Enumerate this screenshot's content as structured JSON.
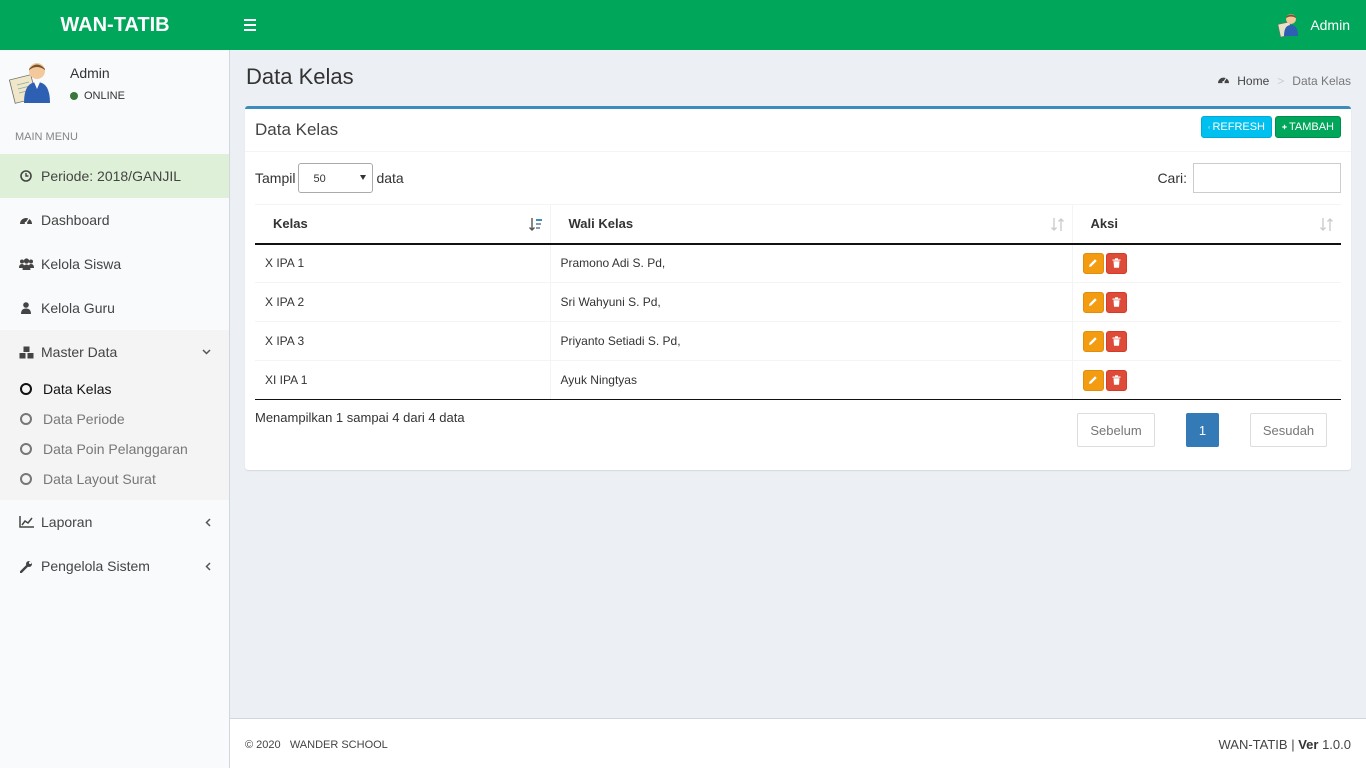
{
  "app": {
    "title": "WAN-TATIB"
  },
  "topbar": {
    "user": "Admin",
    "menu_icon": "bars-icon"
  },
  "sidebar": {
    "user": {
      "name": "Admin",
      "status": "ONLINE"
    },
    "menu_header": "MAIN MENU",
    "periode": "Periode: 2018/GANJIL",
    "items": [
      {
        "label": "Dashboard",
        "icon": "dashboard-icon"
      },
      {
        "label": "Kelola Siswa",
        "icon": "users-icon"
      },
      {
        "label": "Kelola Guru",
        "icon": "user-icon"
      },
      {
        "label": "Master Data",
        "icon": "cubes-icon"
      }
    ],
    "submenu": [
      {
        "label": "Data Kelas",
        "active": true
      },
      {
        "label": "Data Periode"
      },
      {
        "label": "Data Poin Pelanggaran"
      },
      {
        "label": "Data Layout Surat"
      }
    ],
    "after_items": [
      {
        "label": "Laporan",
        "icon": "line-chart-icon"
      },
      {
        "label": "Pengelola Sistem",
        "icon": "wrench-icon"
      }
    ]
  },
  "page": {
    "title": "Data Kelas",
    "breadcrumb": {
      "home": "Home",
      "current": "Data Kelas"
    }
  },
  "box": {
    "title": "Data Kelas",
    "refresh_label": "REFRESH",
    "tambah_label": "TAMBAH",
    "length": {
      "prefix": "Tampil",
      "value": "50",
      "suffix": "data"
    },
    "search": {
      "label": "Cari:",
      "value": ""
    },
    "columns": [
      "Kelas",
      "Wali Kelas",
      "Aksi"
    ],
    "rows": [
      {
        "kelas": "X IPA 1",
        "wali": "Pramono Adi S. Pd,"
      },
      {
        "kelas": "X IPA 2",
        "wali": "Sri Wahyuni S. Pd,"
      },
      {
        "kelas": "X IPA 3",
        "wali": "Priyanto Setiadi S. Pd,"
      },
      {
        "kelas": "XI IPA 1",
        "wali": "Ayuk Ningtyas"
      }
    ],
    "info": "Menampilkan 1 sampai 4 dari 4 data",
    "pager": {
      "prev": "Sebelum",
      "page": "1",
      "next": "Sesudah"
    }
  },
  "footer": {
    "copyright": "© 2020",
    "school": "WANDER SCHOOL",
    "app": "WAN-TATIB |",
    "ver_label": "Ver",
    "ver": "1.0.0"
  },
  "colors": {
    "header": "#00a65a",
    "box_border": "#3c8dbc",
    "refresh": "#00c0ef",
    "tambah": "#00a65a",
    "edit": "#f39c12",
    "delete": "#dd4b39",
    "page_active": "#337ab7"
  }
}
